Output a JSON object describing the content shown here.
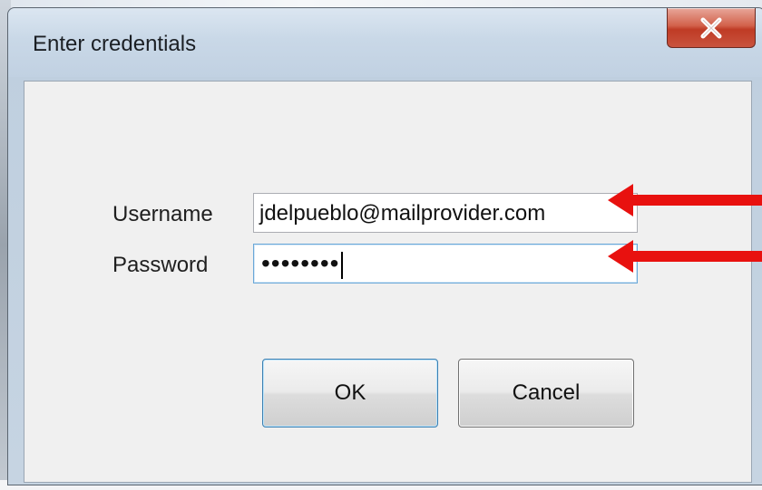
{
  "window": {
    "title": "Enter credentials",
    "close_icon": "close-x-icon"
  },
  "form": {
    "username_label": "Username",
    "username_value": "jdelpueblo@mailprovider.com",
    "password_label": "Password",
    "password_masked": "••••••••"
  },
  "buttons": {
    "ok_label": "OK",
    "cancel_label": "Cancel"
  },
  "annotations": {
    "arrow_color": "#e8110f",
    "arrow_icon": "left-arrow-icon"
  },
  "colors": {
    "close_button": "#c9533e",
    "focus_border": "#6aa8d8"
  }
}
